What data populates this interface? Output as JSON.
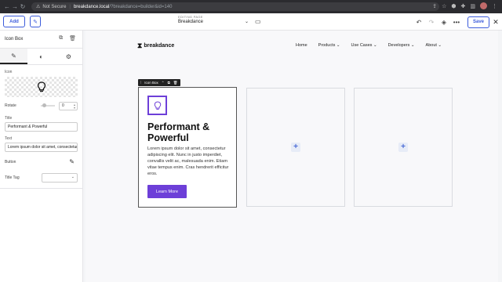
{
  "browser": {
    "security": "Not Secure",
    "host": "breakdance.local",
    "path": "/?breakdance=builder&id=140"
  },
  "toolbar": {
    "add_label": "Add",
    "editing_label": "EDITING PAGE",
    "editing_value": "Breakdance",
    "save_label": "Save"
  },
  "sidebar": {
    "panel_title": "Icon Box",
    "icon_label": "Icon",
    "rotate_label": "Rotate",
    "rotate_value": "0",
    "title_label": "Title",
    "title_value": "Performant & Powerful",
    "text_label": "Text",
    "text_value": "Lorem ipsum dolor sit amet, consectetur ac",
    "button_label": "Button",
    "title_tag_label": "Title Tag"
  },
  "site": {
    "logo_text": "breakdance",
    "menu": [
      "Home",
      "Products ⌄",
      "Use Cases ⌄",
      "Developers ⌄",
      "About ⌄"
    ]
  },
  "iconbox": {
    "tag_label": "Icon Box",
    "title": "Performant & Powerful",
    "text": "Lorem ipsum dolor sit amet, consectetur adipiscing elit. Nunc in justo imperdiet, convallis velit ac, malesuada enim. Etiam vitae tempus enim. Cras hendrerit efficitur eros.",
    "button": "Learn More"
  },
  "colors": {
    "accent": "#6d3fd8",
    "builder_blue": "#3b5bdb"
  }
}
